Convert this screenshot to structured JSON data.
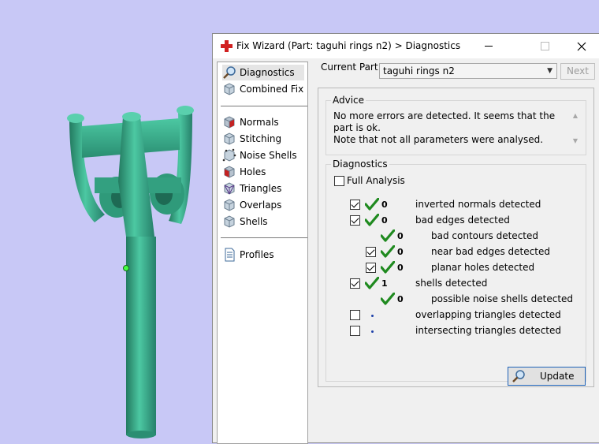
{
  "window": {
    "title": "Fix Wizard (Part: taguhi rings n2) > Diagnostics",
    "minimize_icon": "minimize-icon",
    "maximize_icon": "maximize-icon",
    "close_icon": "close-icon"
  },
  "nav": {
    "group1": [
      {
        "label": "Diagnostics",
        "icon": "magnifier-icon",
        "selected": true
      },
      {
        "label": "Combined Fix",
        "icon": "cube-icon",
        "selected": false
      }
    ],
    "group2": [
      {
        "label": "Normals",
        "icon": "normals-cube-icon"
      },
      {
        "label": "Stitching",
        "icon": "stitching-cube-icon"
      },
      {
        "label": "Noise Shells",
        "icon": "noise-shells-icon"
      },
      {
        "label": "Holes",
        "icon": "holes-cube-icon"
      },
      {
        "label": "Triangles",
        "icon": "triangles-cube-icon"
      },
      {
        "label": "Overlaps",
        "icon": "overlaps-cube-icon"
      },
      {
        "label": "Shells",
        "icon": "shells-cube-icon"
      }
    ],
    "group3": [
      {
        "label": "Profiles",
        "icon": "document-icon"
      }
    ]
  },
  "current_part": {
    "label": "Current Part:",
    "value": "taguhi rings n2",
    "next_label": "Next"
  },
  "advice": {
    "title": "Advice",
    "text_line1": "No more errors are detected. It seems that the part is ok.",
    "text_line2": "Note that not all parameters were analysed."
  },
  "diagnostics": {
    "title": "Diagnostics",
    "full_analysis_label": "Full Analysis",
    "full_analysis_checked": false,
    "rows": [
      {
        "checkbox": true,
        "checked": true,
        "status": "ok",
        "count": "0",
        "label": "inverted normals detected",
        "indent": 0
      },
      {
        "checkbox": true,
        "checked": true,
        "status": "ok",
        "count": "0",
        "label": "bad edges detected",
        "indent": 0
      },
      {
        "checkbox": false,
        "checked": false,
        "status": "ok",
        "count": "0",
        "label": "bad contours detected",
        "indent": 1
      },
      {
        "checkbox": true,
        "checked": true,
        "status": "ok",
        "count": "0",
        "label": "near bad edges detected",
        "indent": 1
      },
      {
        "checkbox": true,
        "checked": true,
        "status": "ok",
        "count": "0",
        "label": "planar holes detected",
        "indent": 1
      },
      {
        "checkbox": true,
        "checked": true,
        "status": "ok",
        "count": "1",
        "label": "shells detected",
        "indent": 0
      },
      {
        "checkbox": false,
        "checked": false,
        "status": "ok",
        "count": "0",
        "label": "possible noise shells detected",
        "indent": 1
      },
      {
        "checkbox": true,
        "checked": false,
        "status": "unknown",
        "count": "",
        "label": "overlapping triangles detected",
        "indent": 0
      },
      {
        "checkbox": true,
        "checked": false,
        "status": "unknown",
        "count": "",
        "label": "intersecting triangles detected",
        "indent": 0
      }
    ],
    "update_label": "Update"
  },
  "colors": {
    "viewport_bg": "#c8c8f6",
    "model_color": "#3cae8c",
    "check_green": "#1f8a1f",
    "accent_blue": "#1e62b8"
  }
}
